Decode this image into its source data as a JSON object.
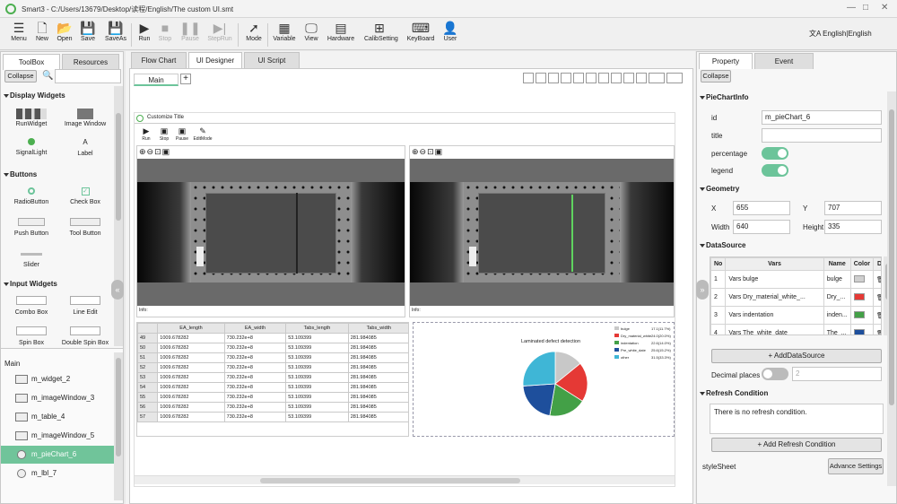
{
  "app": {
    "title": "Smart3 - C:/Users/13679/Desktop/读程/English/The custom UI.smt"
  },
  "toolbar": {
    "items": [
      {
        "label": "Menu",
        "icon": "hamburger-icon"
      },
      {
        "label": "New",
        "icon": "new-file-icon"
      },
      {
        "label": "Open",
        "icon": "folder-icon"
      },
      {
        "label": "Save",
        "icon": "save-icon"
      },
      {
        "label": "SaveAs",
        "icon": "save-as-icon"
      },
      {
        "label": "Run",
        "icon": "play-icon"
      },
      {
        "label": "Stop",
        "icon": "stop-icon",
        "disabled": true
      },
      {
        "label": "Pause",
        "icon": "pause-icon",
        "disabled": true
      },
      {
        "label": "StepRun",
        "icon": "step-icon",
        "disabled": true
      },
      {
        "label": "Mode",
        "icon": "mode-icon"
      },
      {
        "label": "Variable",
        "icon": "variable-icon"
      },
      {
        "label": "View",
        "icon": "view-icon"
      },
      {
        "label": "Hardware",
        "icon": "hardware-icon"
      },
      {
        "label": "CalibSetting",
        "icon": "calib-icon"
      },
      {
        "label": "KeyBoard",
        "icon": "keyboard-icon"
      },
      {
        "label": "User",
        "icon": "user-icon"
      }
    ],
    "language": "English|English"
  },
  "left": {
    "tabs": [
      "ToolBox",
      "Resources"
    ],
    "collapse": "Collapse",
    "sections": {
      "display": "Display Widgets",
      "buttons": "Buttons",
      "input": "Input Widgets"
    },
    "widgets": {
      "run_widget": "RunWidget",
      "image_window": "Image Window",
      "signal_light": "SignalLight",
      "label": "Label",
      "radio_button": "RadioButton",
      "check_box": "Check Box",
      "push_button": "Push Button",
      "tool_button": "Tool Button",
      "slider": "Slider",
      "combo_box": "Combo Box",
      "line_edit": "Line Edit",
      "spin_box": "Spin Box",
      "double_spin_box": "Double Spin Box"
    },
    "tree_title": "Main",
    "tree": [
      {
        "label": "m_widget_2"
      },
      {
        "label": "m_imageWindow_3"
      },
      {
        "label": "m_table_4"
      },
      {
        "label": "m_imageWindow_5"
      },
      {
        "label": "m_pieChart_6",
        "selected": true
      },
      {
        "label": "m_lbl_7"
      }
    ]
  },
  "center": {
    "tabs": [
      "Flow Chart",
      "UI Designer",
      "UI Script"
    ],
    "page_tab": "Main",
    "form_title": "Customize Title",
    "run_buttons": [
      "Run",
      "Stop",
      "Pause",
      "EditMode"
    ],
    "img_info_1": "Info:",
    "img_info_2": "Info:",
    "table": {
      "headers": [
        "",
        "EA_length",
        "EA_width",
        "Tabs_length",
        "Tabs_width"
      ],
      "rows": [
        [
          "49",
          "1009.678282",
          "730.232e+8",
          "53.109399",
          "281.984085"
        ],
        [
          "50",
          "1009.678282",
          "730.232e+8",
          "53.109399",
          "281.984085"
        ],
        [
          "51",
          "1009.678282",
          "730.232e+8",
          "53.109399",
          "281.984085"
        ],
        [
          "52",
          "1009.678282",
          "730.232e+8",
          "53.109399",
          "281.984085"
        ],
        [
          "53",
          "1009.678282",
          "730.232e+8",
          "53.109399",
          "281.984085"
        ],
        [
          "54",
          "1009.678282",
          "730.232e+8",
          "53.109399",
          "281.984085"
        ],
        [
          "55",
          "1009.678282",
          "730.232e+8",
          "53.109399",
          "281.984085"
        ],
        [
          "56",
          "1009.678282",
          "730.232e+8",
          "53.109399",
          "281.984085"
        ],
        [
          "57",
          "1009.678282",
          "730.232e+8",
          "53.109399",
          "281.984085"
        ]
      ]
    },
    "pie": {
      "title": "Laminated defect detection",
      "slices": [
        {
          "name": "bulge",
          "value": 17.1,
          "color": "#c8c8c8",
          "pct": "17.1(11.7%)"
        },
        {
          "name": "Dry_material_white_mark",
          "value": 24.0,
          "color": "#e53935",
          "pct": "24.0(20.0%)"
        },
        {
          "name": "indentation",
          "value": 22.6,
          "color": "#43a047",
          "pct": "22.6(14.0%)"
        },
        {
          "name": "Pre_white_date",
          "value": 25.6,
          "color": "#1e4f9c",
          "pct": "25.6(15.2%)"
        },
        {
          "name": "other",
          "value": 31.5,
          "color": "#3fb6d6",
          "pct": "31.5(33.3%)"
        }
      ]
    }
  },
  "right": {
    "tabs": [
      "Property",
      "Event"
    ],
    "collapse": "Collapse",
    "pie_info": {
      "section": "PieChartInfo",
      "id_label": "id",
      "id_value": "m_pieChart_6",
      "title_label": "title",
      "title_value": "",
      "percentage_label": "percentage",
      "percentage_on": true,
      "legend_label": "legend",
      "legend_on": true
    },
    "geometry": {
      "section": "Geometry",
      "x_label": "X",
      "x": "655",
      "y_label": "Y",
      "y": "707",
      "w_label": "Width",
      "w": "640",
      "h_label": "Height",
      "h": "335"
    },
    "datasource": {
      "section": "DataSource",
      "headers": [
        "No",
        "Vars",
        "Name",
        "Color",
        "De"
      ],
      "rows": [
        {
          "no": "1",
          "vars": "Vars bulge",
          "name": "bulge",
          "color": "#cfcfcf"
        },
        {
          "no": "2",
          "vars": "Vars Dry_material_white_...",
          "name": "Dry_...",
          "color": "#e53935"
        },
        {
          "no": "3",
          "vars": "Vars indentation",
          "name": "inden...",
          "color": "#43a047"
        },
        {
          "no": "4",
          "vars": "Vars The_white_date",
          "name": "The_...",
          "color": "#1e4f9c"
        }
      ],
      "add_button": "+ AddDataSource",
      "decimal_label": "Decimal places",
      "decimal_value": "2"
    },
    "refresh": {
      "section": "Refresh Condition",
      "text": "There is no refresh condition.",
      "add_button": "+ Add Refresh Condition"
    },
    "stylesheet_label": "styleSheet",
    "advanced_button": "Advance Settings"
  }
}
